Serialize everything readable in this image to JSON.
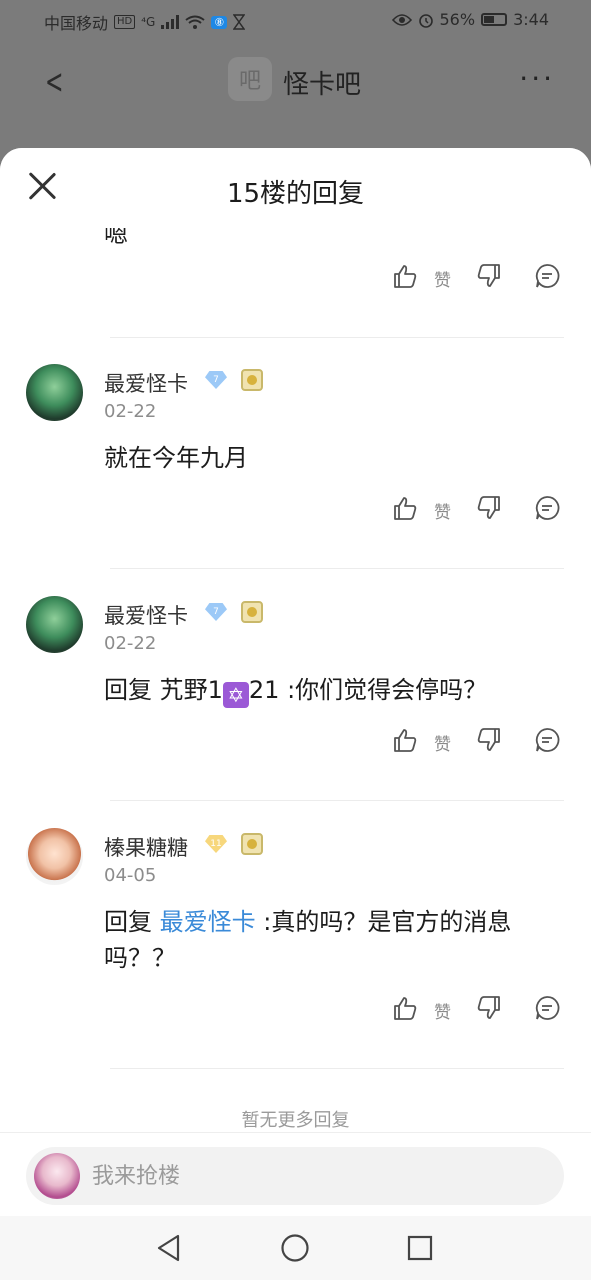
{
  "status_bar": {
    "carrier": "中国移动",
    "hd": "HD",
    "net": "⁴G",
    "bt": "⑧",
    "battery_percent": "56%",
    "battery_level": 0.56,
    "time": "3:44"
  },
  "app_bar": {
    "logo_text": "吧",
    "title": "怪卡吧"
  },
  "sheet": {
    "title": "15楼的回复",
    "partial_text": "嗯"
  },
  "actions": {
    "like_label": "赞"
  },
  "replies": [
    {
      "username": "最爱怪卡",
      "level": "7",
      "date": "02-22",
      "content": "就在今年九月"
    },
    {
      "username": "最爱怪卡",
      "level": "7",
      "date": "02-22",
      "prefix": "回复 艽野1",
      "emoji": "✡",
      "suffix": "21 :你们觉得会停吗？"
    },
    {
      "username": "榛果糖糖",
      "level": "11",
      "date": "04-05",
      "prefix": "回复 ",
      "mention": "最爱怪卡",
      "suffix": " :真的吗？是官方的消息吗？？"
    }
  ],
  "no_more_text": "暂无更多回复",
  "composer": {
    "placeholder": "我来抢楼"
  },
  "colors": {
    "accent": "#3a8ad8",
    "overlay": "#7b7b7b"
  }
}
